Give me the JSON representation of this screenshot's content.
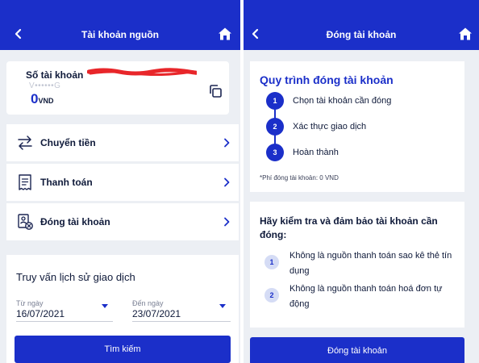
{
  "colors": {
    "brand": "#1b2fc9",
    "background": "#eceff4",
    "text": "#0f1a3a",
    "step_badge_light": "#d5dcf5",
    "redaction": "#e8262a"
  },
  "left_screen": {
    "header": {
      "title": "Tài khoản nguồn",
      "back_icon": "chevron-left-icon",
      "home_icon": "home-icon"
    },
    "account_card": {
      "label": "Số tài khoản",
      "account_name_partial": "V••••••G",
      "balance": "0",
      "currency": "VND",
      "copy_icon": "copy-icon"
    },
    "menu": [
      {
        "label": "Chuyển tiền",
        "icon": "transfer-icon"
      },
      {
        "label": "Thanh toán",
        "icon": "bill-icon"
      },
      {
        "label": "Đóng tài khoản",
        "icon": "close-account-icon"
      }
    ],
    "history": {
      "title": "Truy vấn lịch sử giao dịch",
      "from_label": "Từ ngày",
      "from_value": "16/07/2021",
      "to_label": "Đến ngày",
      "to_value": "23/07/2021",
      "search_button": "Tìm kiếm"
    }
  },
  "right_screen": {
    "header": {
      "title": "Đóng tài khoản",
      "back_icon": "chevron-left-icon",
      "home_icon": "home-icon"
    },
    "process": {
      "title": "Quy trình đóng tài khoản",
      "steps": [
        {
          "num": "1",
          "text": "Chọn tài khoản cần đóng"
        },
        {
          "num": "2",
          "text": "Xác thực giao dịch"
        },
        {
          "num": "3",
          "text": "Hoàn thành"
        }
      ],
      "fee_note": "*Phí đóng tài khoản: 0 VND"
    },
    "checklist": {
      "title": "Hãy kiểm tra và đảm bảo tài khoản cần đóng:",
      "items": [
        {
          "num": "1",
          "text": "Không là nguồn thanh toán sao kê thẻ tín dụng"
        },
        {
          "num": "2",
          "text": "Không là nguồn thanh toán hoá đơn tự động"
        }
      ]
    },
    "close_button": "Đóng tài khoản"
  }
}
